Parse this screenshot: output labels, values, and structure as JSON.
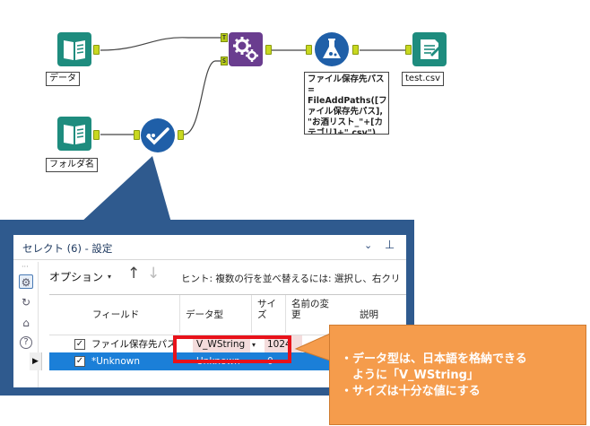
{
  "workflow": {
    "tools": {
      "data_input": {
        "label": "データ"
      },
      "folder_input": {
        "label": "フォルダ名"
      },
      "append_fields": {
        "connector_t": "T",
        "connector_s": "S"
      },
      "formula": {
        "label": "ファイル保存先パス\n= FileAddPaths([ファイル保存先パス],\n\"お酒リスト_\"+[カテゴリ]+\".csv\")"
      },
      "output": {
        "label": "test.csv"
      }
    }
  },
  "panel": {
    "title": "セレクト (6) - 設定",
    "options_label": "オプション",
    "hint": "ヒント: 複数の行を並べ替えるには: 選択し、右クリ",
    "columns": [
      "フィールド",
      "データ型",
      "サイズ",
      "名前の変更",
      "説明"
    ],
    "rows": [
      {
        "field": "ファイル保存先パス",
        "type": "V_WString",
        "size": "1024",
        "rename": "",
        "checked": "✓"
      },
      {
        "field": "*Unknown",
        "type": "Unknown",
        "size": "0",
        "rename": "",
        "checked": "✓"
      }
    ],
    "side_icons": [
      "gear-icon",
      "connect-icon",
      "tag-icon",
      "help-icon"
    ]
  },
  "callout": {
    "lines": [
      "・データ型は、日本語を格納できる",
      "　ように「V_WString」",
      "・サイズは十分な値にする"
    ]
  },
  "colors": {
    "input_tool": "#1e8c7e",
    "append_tool": "#6a3d8f",
    "formula_tool": "#1f5fa8",
    "select_tool": "#1f5fa8",
    "output_tool": "#1e8c7e",
    "panel_frame": "#2f5a8e",
    "callout": "#f59c4c",
    "highlight": "#e8121a"
  }
}
